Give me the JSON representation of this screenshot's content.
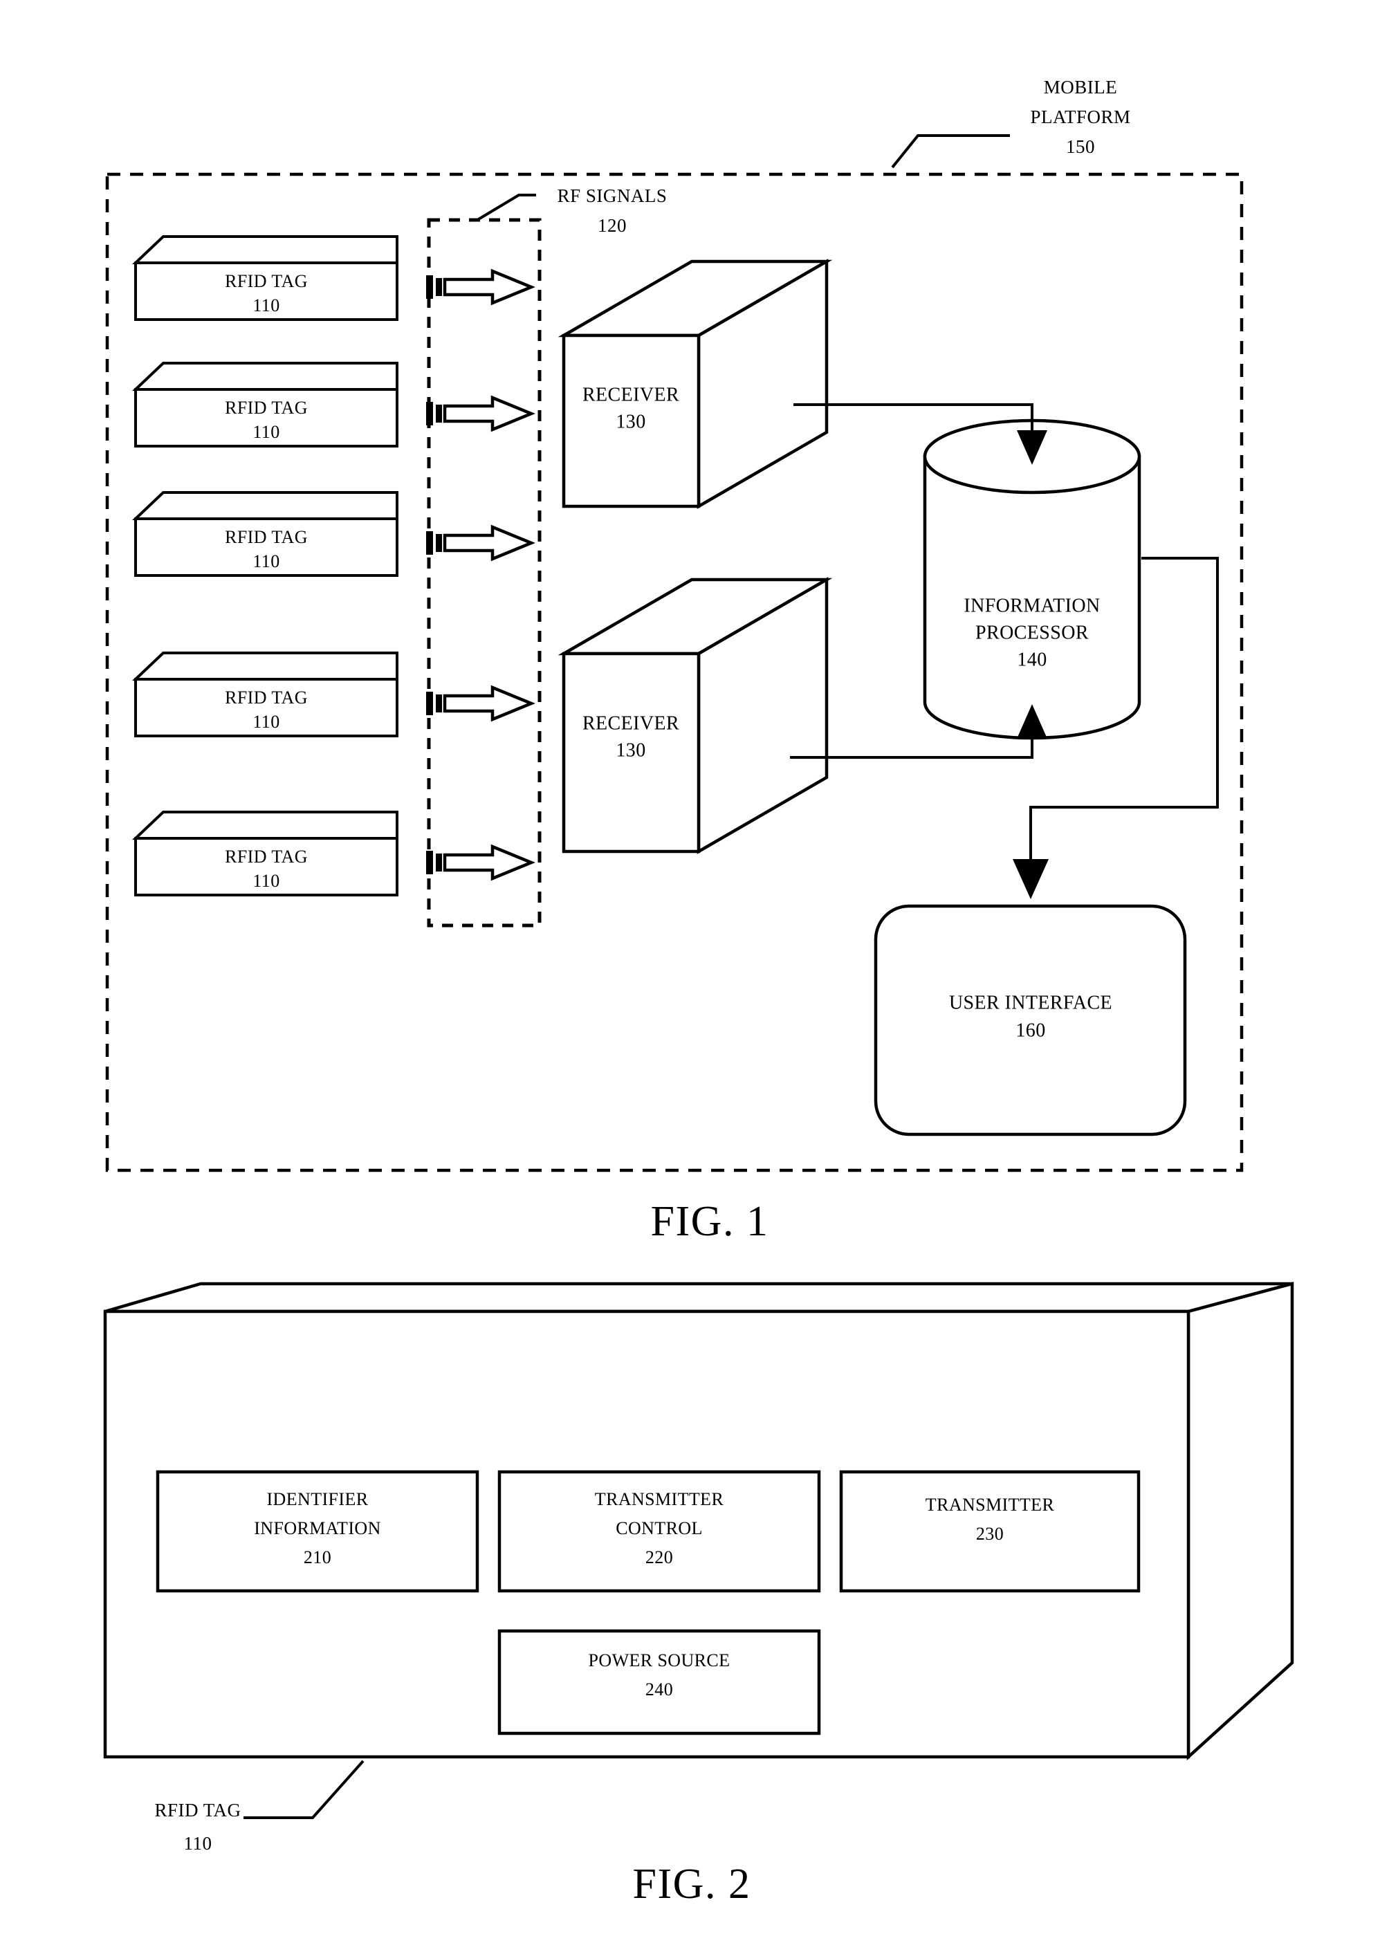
{
  "document": {
    "type": "patent-drawing-sheet",
    "figures": [
      {
        "caption": "FIG. 1",
        "title_label": {
          "line1": "MOBILE",
          "line2": "PLATFORM",
          "ref": "150"
        },
        "signals_label": {
          "line1": "RF SIGNALS",
          "ref": "120"
        },
        "tags": [
          {
            "line1": "RFID TAG",
            "ref": "110"
          },
          {
            "line1": "RFID TAG",
            "ref": "110"
          },
          {
            "line1": "RFID TAG",
            "ref": "110"
          },
          {
            "line1": "RFID TAG",
            "ref": "110"
          },
          {
            "line1": "RFID TAG",
            "ref": "110"
          }
        ],
        "receivers": [
          {
            "line1": "RECEIVER",
            "ref": "130"
          },
          {
            "line1": "RECEIVER",
            "ref": "130"
          }
        ],
        "processor": {
          "line1": "INFORMATION",
          "line2": "PROCESSOR",
          "ref": "140"
        },
        "user_interface": {
          "line1": "USER INTERFACE",
          "ref": "160"
        }
      },
      {
        "caption": "FIG. 2",
        "device_label": {
          "line1": "RFID TAG",
          "ref": "110"
        },
        "blocks": [
          {
            "line1": "IDENTIFIER",
            "line2": "INFORMATION",
            "ref": "210"
          },
          {
            "line1": "TRANSMITTER",
            "line2": "CONTROL",
            "ref": "220"
          },
          {
            "line1": "TRANSMITTER",
            "line2": "",
            "ref": "230"
          },
          {
            "line1": "POWER SOURCE",
            "line2": "",
            "ref": "240"
          }
        ]
      }
    ]
  },
  "colors": {
    "ink": "#000000",
    "paper": "#ffffff"
  }
}
